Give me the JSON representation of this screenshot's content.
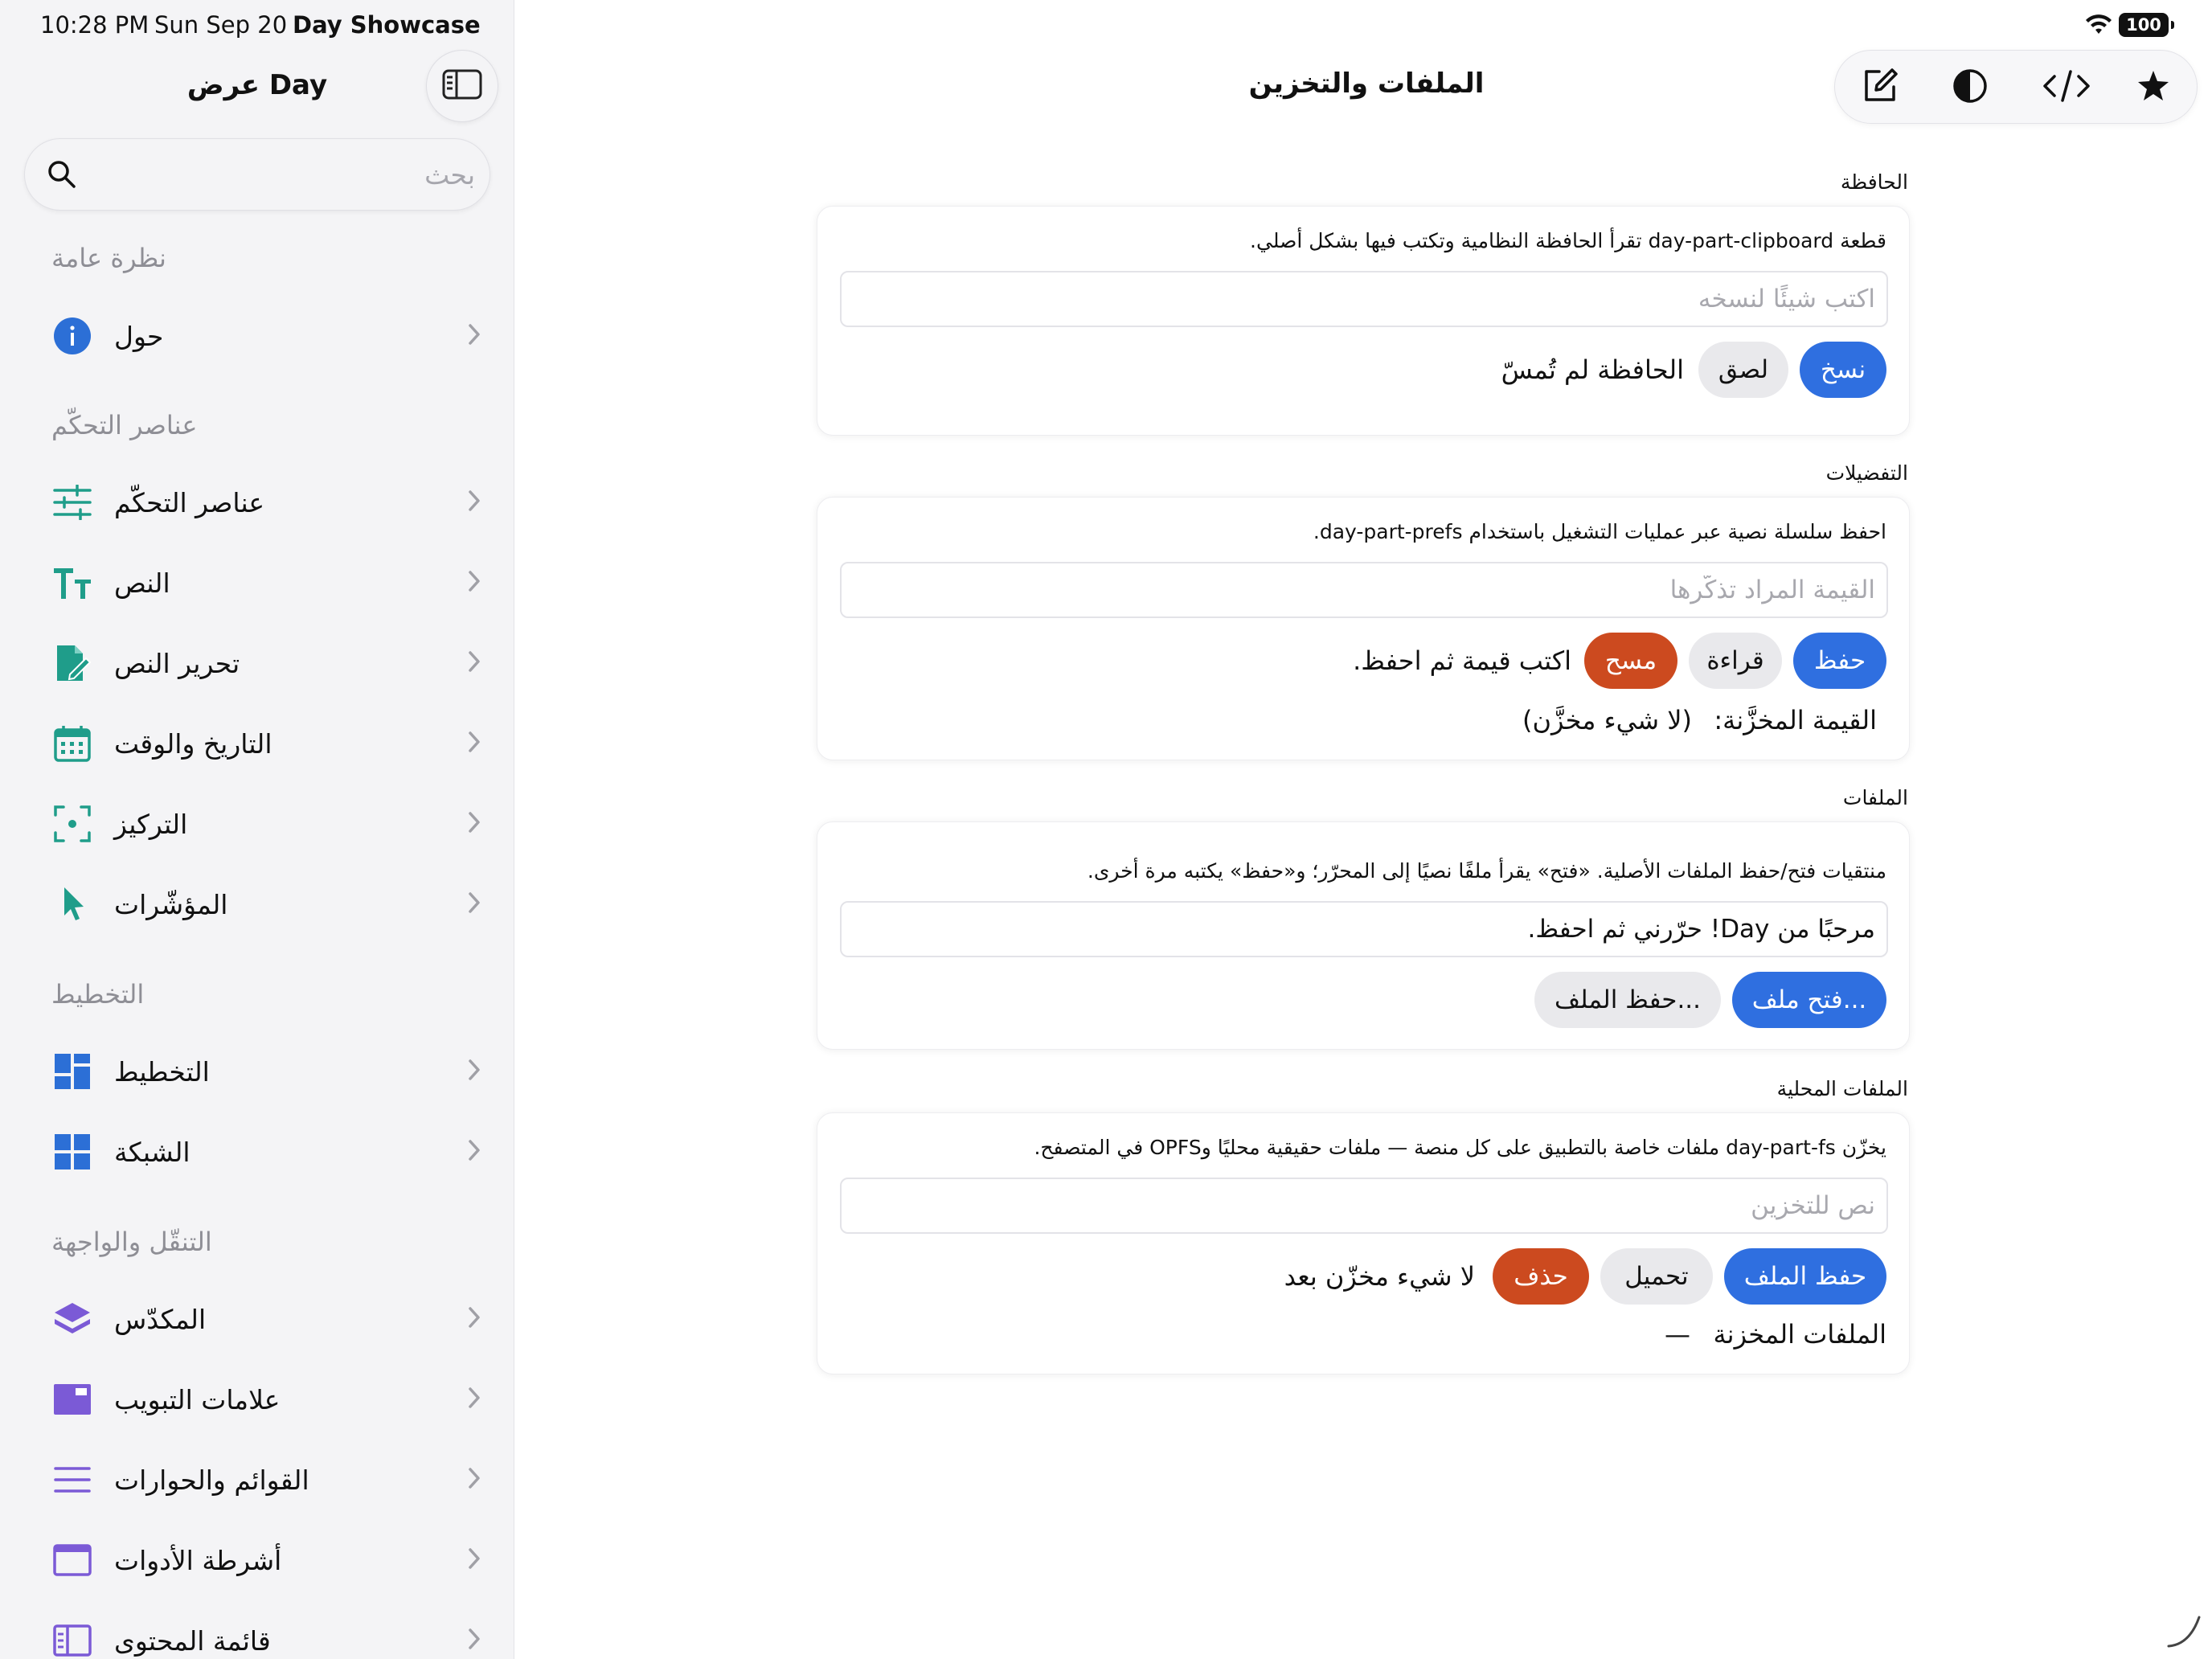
{
  "status_bar": {
    "time": "10:28 PM",
    "date": "Sun Sep 20",
    "app": "Day Showcase",
    "battery": "100"
  },
  "sidebar": {
    "title": "عرض Day",
    "search_placeholder": "بحث",
    "sections": [
      {
        "header": "نظرة عامة",
        "items": [
          {
            "label": "حول",
            "icon": "info-icon"
          }
        ]
      },
      {
        "header": "عناصر التحكّم",
        "items": [
          {
            "label": "عناصر التحكّم",
            "icon": "sliders-icon"
          },
          {
            "label": "النص",
            "icon": "text-size-icon"
          },
          {
            "label": "تحرير النص",
            "icon": "document-edit-icon"
          },
          {
            "label": "التاريخ والوقت",
            "icon": "calendar-icon"
          },
          {
            "label": "التركيز",
            "icon": "focus-icon"
          },
          {
            "label": "المؤشّرات",
            "icon": "pointer-icon"
          }
        ]
      },
      {
        "header": "التخطيط",
        "items": [
          {
            "label": "التخطيط",
            "icon": "layout-icon"
          },
          {
            "label": "الشبكة",
            "icon": "grid-icon"
          }
        ]
      },
      {
        "header": "التنقّل والواجهة",
        "items": [
          {
            "label": "المكدّس",
            "icon": "stack-icon"
          },
          {
            "label": "علامات التبويب",
            "icon": "tabs-icon"
          },
          {
            "label": "القوائم والحوارات",
            "icon": "menu-lines-icon"
          },
          {
            "label": "أشرطة الأدوات",
            "icon": "toolbar-icon"
          },
          {
            "label": "قائمة المحتوى",
            "icon": "content-list-icon"
          }
        ]
      }
    ]
  },
  "header": {
    "title": "الملفات والتخزين",
    "toolbar": [
      "compose-icon",
      "contrast-icon",
      "code-icon",
      "star-icon"
    ]
  },
  "clipboard": {
    "label": "الحافظة",
    "description": "قطعة day-part-clipboard تقرأ الحافظة النظامية وتكتب فيها بشكل أصلي.",
    "placeholder": "اكتب شيئًا لنسخه",
    "copy": "نسخ",
    "paste": "لصق",
    "status": "الحافظة لم تُمسّ"
  },
  "prefs": {
    "label": "التفضيلات",
    "description": "احفظ سلسلة نصية عبر عمليات التشغيل باستخدام day-part-prefs.",
    "placeholder": "القيمة المراد تذكّرها",
    "save": "حفظ",
    "read": "قراءة",
    "clear": "مسح",
    "status": "اكتب قيمة ثم احفظ.",
    "stored_label": "القيمة المخزَّنة:",
    "stored_value": "(لا شيء مخزَّن)"
  },
  "files": {
    "label": "الملفات",
    "description": "منتقيات فتح/حفظ الملفات الأصلية. «فتح» يقرأ ملفًا نصيًا إلى المحرّر؛ و«حفظ» يكتبه مرة أخرى.",
    "value": "مرحبًا من Day! حرّرني ثم احفظ.",
    "open": "فتح ملف...",
    "save": "حفظ الملف..."
  },
  "local_files": {
    "label": "الملفات المحلية",
    "description": "يخزّن day-part-fs ملفات خاصة بالتطبيق على كل منصة — ملفات حقيقية محليًا وOPFS في المتصفح.",
    "placeholder": "نص للتخزين",
    "save": "حفظ الملف",
    "load": "تحميل",
    "delete": "حذف",
    "status": "لا شيء مخزّن بعد",
    "stored_label": "الملفات المخزنة",
    "stored_value": "—"
  },
  "colors": {
    "accent_blue": "#2f6fe0",
    "destructive": "#cc4a1f",
    "teal_icon": "#1f9d8a",
    "blue_icon": "#2c6fd6",
    "purple_icon": "#7b5ad6"
  }
}
